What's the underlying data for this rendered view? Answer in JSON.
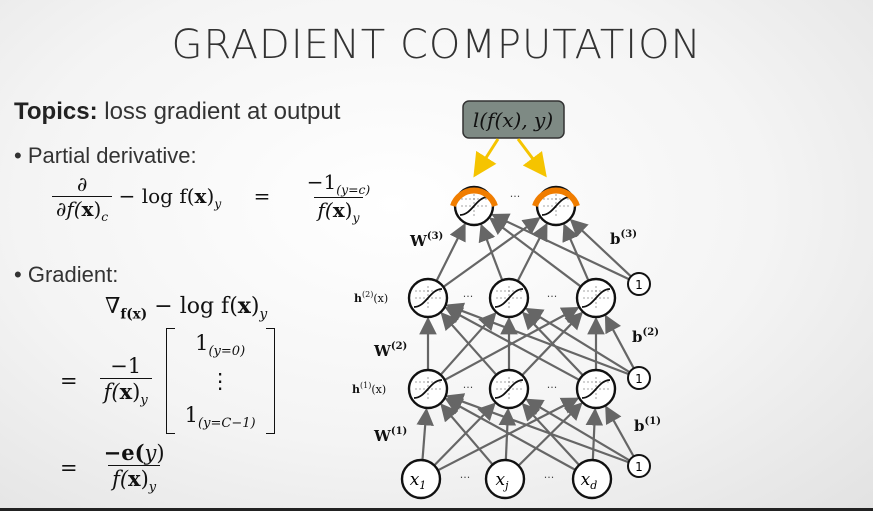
{
  "slide": {
    "title": "GRADIENT COMPUTATION",
    "topics_label": "Topics:",
    "topics_text": " loss gradient at output",
    "bullet1": "Partial derivative:",
    "bullet2": "Gradient:"
  },
  "math": {
    "partial_sym": "∂",
    "partial_den_fx": "∂f(",
    "x_bold": "x",
    "sub_c": "c",
    "minus_log": "− log f(",
    "sub_y": "y",
    "equals": "=",
    "num_minus1": "−1",
    "indicator_yc": "(y=c)",
    "f_paren": "f(",
    "close_paren": ")",
    "grad_sym": "∇",
    "grad_sub": "f(x)",
    "one": "1",
    "ind_first": "(y=0)",
    "vdots": "⋮",
    "ind_last": "(y=C−1)",
    "minus_e": "−e(",
    "y_var": "y"
  },
  "network": {
    "loss_node": "l(f(x), y)",
    "ellipsis": "···",
    "W3": "W",
    "W2": "W",
    "W1": "W",
    "sup3": "(3)",
    "sup2": "(2)",
    "sup1": "(1)",
    "b3": "b",
    "b2": "b",
    "b1": "b",
    "h2": "h",
    "h1": "h",
    "hx": "(x)",
    "bias_one": "1",
    "x1": "x",
    "x1_sub": "1",
    "xj": "x",
    "xj_sub": "j",
    "xd": "x",
    "xd_sub": "d"
  },
  "colors": {
    "output_arc": "#f07d00",
    "gradient_arrows": "#f5c400",
    "loss_box_fill": "#7e8a84",
    "edge_gray": "#666666"
  }
}
